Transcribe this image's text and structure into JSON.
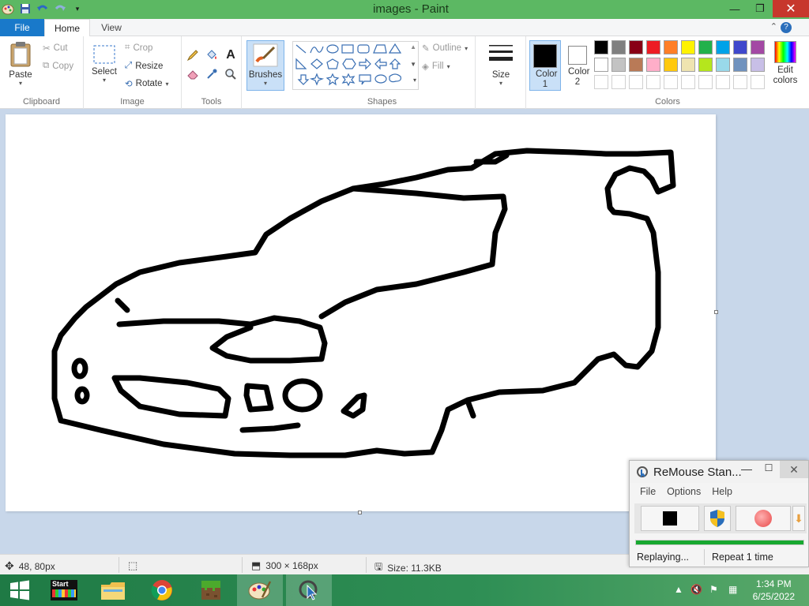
{
  "window": {
    "title": "images - Paint"
  },
  "tabs": [
    "File",
    "Home",
    "View"
  ],
  "clipboard": {
    "group": "Clipboard",
    "paste": "Paste",
    "cut": "Cut",
    "copy": "Copy"
  },
  "image": {
    "group": "Image",
    "select": "Select",
    "crop": "Crop",
    "resize": "Resize",
    "rotate": "Rotate"
  },
  "tools": {
    "group": "Tools"
  },
  "brushes": {
    "label": "Brushes"
  },
  "shapes": {
    "group": "Shapes",
    "outline": "Outline",
    "fill": "Fill"
  },
  "size": {
    "label": "Size"
  },
  "colors": {
    "group": "Colors",
    "color1": "Color 1",
    "color2": "Color 2",
    "edit": "Edit colors",
    "color1_value": "#000000",
    "color2_value": "#ffffff",
    "palette_row1": [
      "#000000",
      "#7f7f7f",
      "#880015",
      "#ed1c24",
      "#ff7f27",
      "#fff200",
      "#22b14c",
      "#00a2e8",
      "#3f48cc",
      "#a349a4"
    ],
    "palette_row2": [
      "#ffffff",
      "#c3c3c3",
      "#b97a57",
      "#ffaec9",
      "#ffc90e",
      "#efe4b0",
      "#b5e61d",
      "#99d9ea",
      "#7092be",
      "#c8bfe7"
    ],
    "palette_row3": [
      "#ffffff",
      "#ffffff",
      "#ffffff",
      "#ffffff",
      "#ffffff",
      "#ffffff",
      "#ffffff",
      "#ffffff",
      "#ffffff",
      "#ffffff"
    ]
  },
  "status": {
    "cursor": "48, 80px",
    "selection_size": "",
    "image_size": "300 × 168px",
    "file_size": "Size: 11.3KB"
  },
  "remouse": {
    "title": "ReMouse Stan...",
    "menu": [
      "File",
      "Options",
      "Help"
    ],
    "progress": 1.0,
    "status": "Replaying...",
    "repeat": "Repeat 1 time"
  },
  "taskbar": {
    "start_label": "Start",
    "time": "1:34 PM",
    "date": "6/25/2022"
  }
}
